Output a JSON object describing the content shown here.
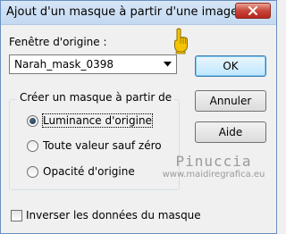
{
  "window": {
    "title": "Ajout d'un masque à partir d'une image",
    "close_icon": "close-icon"
  },
  "source": {
    "label": "Fenêtre d'origine :",
    "selected_value": "Narah_mask_0398",
    "dropdown_icon": "chevron-down-icon",
    "pointer_icon": "pointing-hand-icon"
  },
  "buttons": {
    "ok": "OK",
    "cancel": "Annuler",
    "help": "Aide"
  },
  "mask_group": {
    "label": "Créer un masque à partir de",
    "options": [
      {
        "label": "Luminance d'origine",
        "checked": true
      },
      {
        "label": "Toute valeur sauf zéro",
        "checked": false
      },
      {
        "label": "Opacité d'origine",
        "checked": false
      }
    ]
  },
  "invert": {
    "label": "Inverser les données du masque",
    "checked": false
  },
  "watermark": {
    "name": "Pinuccia",
    "url": "www.maidiregrafica.eu"
  },
  "colors": {
    "titlebar": "#c9ddf2",
    "close_button": "#c9453a",
    "default_button_border": "#3c7fb1",
    "watermark": "#9a9a9a",
    "hand_icon": "#f5c400"
  }
}
